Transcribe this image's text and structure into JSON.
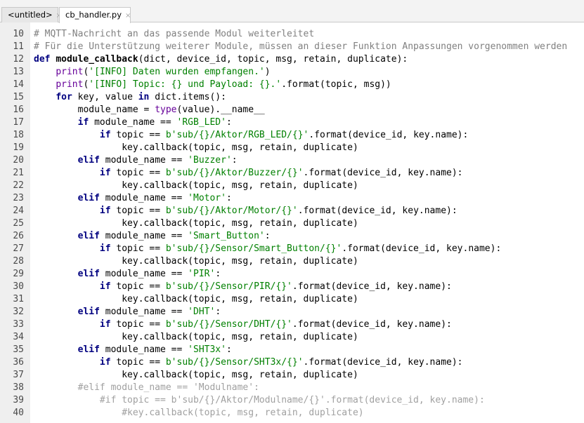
{
  "tabs": [
    {
      "label": "<untitled>",
      "close": "×",
      "active": false
    },
    {
      "label": "cb_handler.py",
      "close": "×",
      "active": true
    }
  ],
  "theme": {
    "keyword": "#000080",
    "string": "#008000",
    "comment": "#808080",
    "disabled_comment": "#a0a0a0",
    "builtin": "#660099",
    "gutter_bg": "#efefef"
  },
  "editor": {
    "lines": [
      {
        "num": "10",
        "tokens": [
          [
            "cm",
            "# MQTT-Nachricht an das passende Modul weiterleitet"
          ]
        ]
      },
      {
        "num": "11",
        "tokens": [
          [
            "cm",
            "# Für die Unterstützung weiterer Module, müssen an dieser Funktion Anpassungen vorgenommen werden"
          ]
        ]
      },
      {
        "num": "12",
        "tokens": [
          [
            "kw",
            "def "
          ],
          [
            "fn",
            "module_callback"
          ],
          [
            "txt",
            "(dict, device_id, topic, msg, retain, duplicate):"
          ]
        ]
      },
      {
        "num": "13",
        "tokens": [
          [
            "txt",
            "    "
          ],
          [
            "call",
            "print"
          ],
          [
            "txt",
            "("
          ],
          [
            "str",
            "'[INFO] Daten wurden empfangen.'"
          ],
          [
            "txt",
            ")"
          ]
        ]
      },
      {
        "num": "14",
        "tokens": [
          [
            "txt",
            "    "
          ],
          [
            "call",
            "print"
          ],
          [
            "txt",
            "("
          ],
          [
            "str",
            "'[INFO] Topic: {} und Payload: {}.'"
          ],
          [
            "txt",
            ".format(topic, msg))"
          ]
        ]
      },
      {
        "num": "15",
        "tokens": [
          [
            "txt",
            "    "
          ],
          [
            "kw",
            "for "
          ],
          [
            "txt",
            "key, value "
          ],
          [
            "kw",
            "in "
          ],
          [
            "txt",
            "dict.items():"
          ]
        ]
      },
      {
        "num": "16",
        "tokens": [
          [
            "txt",
            "        module_name = "
          ],
          [
            "call",
            "type"
          ],
          [
            "txt",
            "(value).__name__"
          ]
        ]
      },
      {
        "num": "17",
        "tokens": [
          [
            "txt",
            "        "
          ],
          [
            "kw",
            "if "
          ],
          [
            "txt",
            "module_name == "
          ],
          [
            "str",
            "'RGB_LED'"
          ],
          [
            "txt",
            ":"
          ]
        ]
      },
      {
        "num": "18",
        "tokens": [
          [
            "txt",
            "            "
          ],
          [
            "kw",
            "if "
          ],
          [
            "txt",
            "topic == "
          ],
          [
            "str",
            "b'sub/{}/Aktor/RGB_LED/{}'"
          ],
          [
            "txt",
            ".format(device_id, key.name):"
          ]
        ]
      },
      {
        "num": "19",
        "tokens": [
          [
            "txt",
            "                key.callback(topic, msg, retain, duplicate)"
          ]
        ]
      },
      {
        "num": "20",
        "tokens": [
          [
            "txt",
            "        "
          ],
          [
            "kw",
            "elif "
          ],
          [
            "txt",
            "module_name == "
          ],
          [
            "str",
            "'Buzzer'"
          ],
          [
            "txt",
            ":"
          ]
        ]
      },
      {
        "num": "21",
        "tokens": [
          [
            "txt",
            "            "
          ],
          [
            "kw",
            "if "
          ],
          [
            "txt",
            "topic == "
          ],
          [
            "str",
            "b'sub/{}/Aktor/Buzzer/{}'"
          ],
          [
            "txt",
            ".format(device_id, key.name):"
          ]
        ]
      },
      {
        "num": "22",
        "tokens": [
          [
            "txt",
            "                key.callback(topic, msg, retain, duplicate)"
          ]
        ]
      },
      {
        "num": "23",
        "tokens": [
          [
            "txt",
            "        "
          ],
          [
            "kw",
            "elif "
          ],
          [
            "txt",
            "module_name == "
          ],
          [
            "str",
            "'Motor'"
          ],
          [
            "txt",
            ":"
          ]
        ]
      },
      {
        "num": "24",
        "tokens": [
          [
            "txt",
            "            "
          ],
          [
            "kw",
            "if "
          ],
          [
            "txt",
            "topic == "
          ],
          [
            "str",
            "b'sub/{}/Aktor/Motor/{}'"
          ],
          [
            "txt",
            ".format(device_id, key.name):"
          ]
        ]
      },
      {
        "num": "25",
        "tokens": [
          [
            "txt",
            "                key.callback(topic, msg, retain, duplicate)"
          ]
        ]
      },
      {
        "num": "26",
        "tokens": [
          [
            "txt",
            "        "
          ],
          [
            "kw",
            "elif "
          ],
          [
            "txt",
            "module_name == "
          ],
          [
            "str",
            "'Smart_Button'"
          ],
          [
            "txt",
            ":"
          ]
        ]
      },
      {
        "num": "27",
        "tokens": [
          [
            "txt",
            "            "
          ],
          [
            "kw",
            "if "
          ],
          [
            "txt",
            "topic == "
          ],
          [
            "str",
            "b'sub/{}/Sensor/Smart_Button/{}'"
          ],
          [
            "txt",
            ".format(device_id, key.name):"
          ]
        ]
      },
      {
        "num": "28",
        "tokens": [
          [
            "txt",
            "                key.callback(topic, msg, retain, duplicate)"
          ]
        ]
      },
      {
        "num": "29",
        "tokens": [
          [
            "txt",
            "        "
          ],
          [
            "kw",
            "elif "
          ],
          [
            "txt",
            "module_name == "
          ],
          [
            "str",
            "'PIR'"
          ],
          [
            "txt",
            ":"
          ]
        ]
      },
      {
        "num": "30",
        "tokens": [
          [
            "txt",
            "            "
          ],
          [
            "kw",
            "if "
          ],
          [
            "txt",
            "topic == "
          ],
          [
            "str",
            "b'sub/{}/Sensor/PIR/{}'"
          ],
          [
            "txt",
            ".format(device_id, key.name):"
          ]
        ]
      },
      {
        "num": "31",
        "tokens": [
          [
            "txt",
            "                key.callback(topic, msg, retain, duplicate)"
          ]
        ]
      },
      {
        "num": "32",
        "tokens": [
          [
            "txt",
            "        "
          ],
          [
            "kw",
            "elif "
          ],
          [
            "txt",
            "module_name == "
          ],
          [
            "str",
            "'DHT'"
          ],
          [
            "txt",
            ":"
          ]
        ]
      },
      {
        "num": "33",
        "tokens": [
          [
            "txt",
            "            "
          ],
          [
            "kw",
            "if "
          ],
          [
            "txt",
            "topic == "
          ],
          [
            "str",
            "b'sub/{}/Sensor/DHT/{}'"
          ],
          [
            "txt",
            ".format(device_id, key.name):"
          ]
        ]
      },
      {
        "num": "34",
        "tokens": [
          [
            "txt",
            "                key.callback(topic, msg, retain, duplicate)"
          ]
        ]
      },
      {
        "num": "35",
        "tokens": [
          [
            "txt",
            "        "
          ],
          [
            "kw",
            "elif "
          ],
          [
            "txt",
            "module_name == "
          ],
          [
            "str",
            "'SHT3x'"
          ],
          [
            "txt",
            ":"
          ]
        ]
      },
      {
        "num": "36",
        "tokens": [
          [
            "txt",
            "            "
          ],
          [
            "kw",
            "if "
          ],
          [
            "txt",
            "topic == "
          ],
          [
            "str",
            "b'sub/{}/Sensor/SHT3x/{}'"
          ],
          [
            "txt",
            ".format(device_id, key.name):"
          ]
        ]
      },
      {
        "num": "37",
        "tokens": [
          [
            "txt",
            "                key.callback(topic, msg, retain, duplicate)"
          ]
        ]
      },
      {
        "num": "38",
        "tokens": [
          [
            "dim",
            "        #elif module_name == 'Modulname':"
          ]
        ]
      },
      {
        "num": "39",
        "tokens": [
          [
            "dim",
            "            #if topic == b'sub/{}/Aktor/Modulname/{}'.format(device_id, key.name):"
          ]
        ]
      },
      {
        "num": "40",
        "tokens": [
          [
            "dim",
            "                #key.callback(topic, msg, retain, duplicate)"
          ]
        ]
      }
    ]
  }
}
